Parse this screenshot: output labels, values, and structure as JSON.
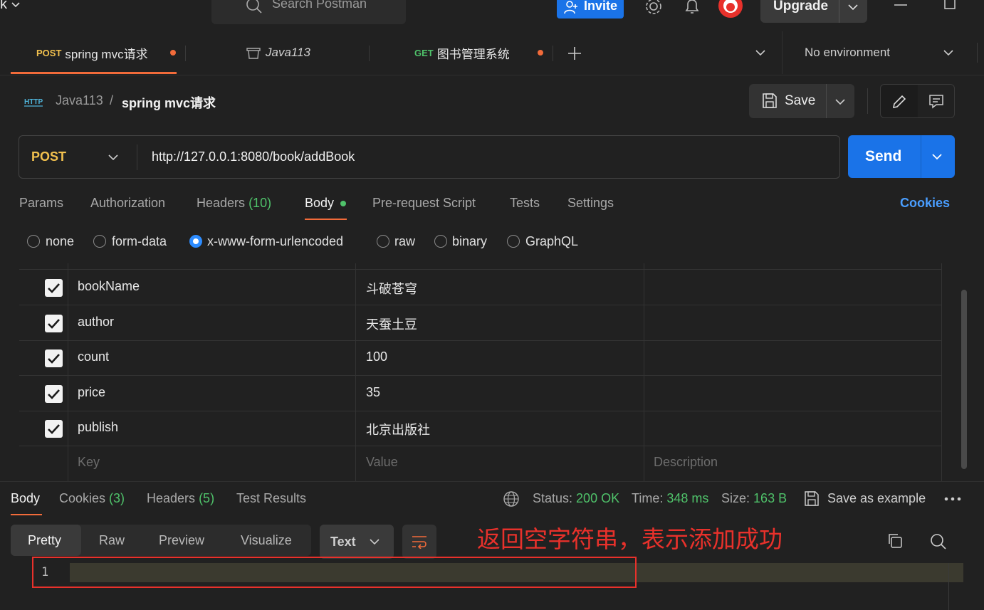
{
  "topbar": {
    "title_fragment": "k",
    "search_placeholder": "Search Postman",
    "invite_label": "Invite",
    "upgrade_label": "Upgrade"
  },
  "tabs": [
    {
      "method": "POST",
      "label": "spring mvc请求",
      "method_color": "#f2c14e",
      "unsaved": true
    },
    {
      "method": "",
      "label": "Java113",
      "icon": "collection-icon",
      "unsaved": false
    },
    {
      "method": "GET",
      "label": "图书管理系统",
      "method_color": "#4fc26a",
      "unsaved": true
    }
  ],
  "environment": "No environment",
  "breadcrumb": {
    "collection": "Java113",
    "separator": "/",
    "request": "spring mvc请求"
  },
  "save_label": "Save",
  "request": {
    "method": "POST",
    "url": "http://127.0.0.1:8080/book/addBook",
    "send_label": "Send"
  },
  "request_tabs": [
    {
      "label": "Params"
    },
    {
      "label": "Authorization"
    },
    {
      "label": "Headers",
      "count": "(10)"
    },
    {
      "label": "Body",
      "active": true
    },
    {
      "label": "Pre-request Script"
    },
    {
      "label": "Tests"
    },
    {
      "label": "Settings"
    }
  ],
  "cookies_link": "Cookies",
  "body_types": [
    "none",
    "form-data",
    "x-www-form-urlencoded",
    "raw",
    "binary",
    "GraphQL"
  ],
  "body_type_selected": "x-www-form-urlencoded",
  "params": [
    {
      "key": "bookName",
      "value": "斗破苍穹",
      "checked": true
    },
    {
      "key": "author",
      "value": "天蚕土豆",
      "checked": true
    },
    {
      "key": "count",
      "value": "100",
      "checked": true
    },
    {
      "key": "price",
      "value": "35",
      "checked": true
    },
    {
      "key": "publish",
      "value": "北京出版社",
      "checked": true
    }
  ],
  "placeholders": {
    "key": "Key",
    "value": "Value",
    "description": "Description"
  },
  "response": {
    "tabs": [
      {
        "label": "Body"
      },
      {
        "label": "Cookies",
        "count": "(3)"
      },
      {
        "label": "Headers",
        "count": "(5)"
      },
      {
        "label": "Test Results"
      }
    ],
    "status_label": "Status:",
    "status": "200 OK",
    "time_label": "Time:",
    "time": "348 ms",
    "size_label": "Size:",
    "size": "163 B",
    "save_example": "Save as example",
    "view_modes": [
      "Pretty",
      "Raw",
      "Preview",
      "Visualize"
    ],
    "format": "Text",
    "line_number": "1",
    "annotation": "返回空字符串，表示添加成功"
  },
  "colors": {
    "accent": "#f26b3a",
    "primary": "#1a73e8",
    "success": "#4fc26a",
    "annotation": "#e8312b"
  }
}
